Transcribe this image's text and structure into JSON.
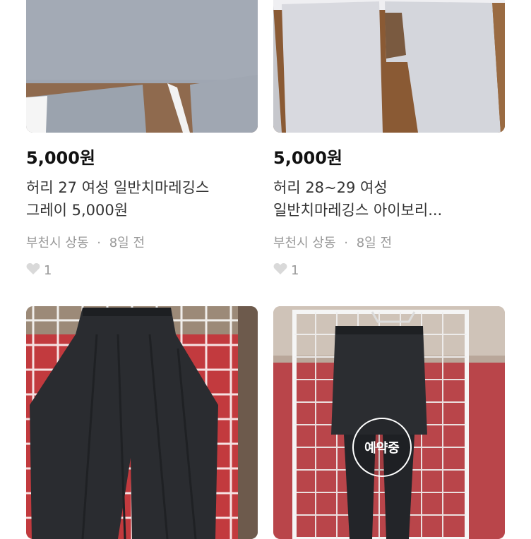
{
  "products": [
    {
      "price": "5,000원",
      "title_line1": "허리 27 여성 일반치마레깅스",
      "title_line2": "그레이 5,000원",
      "location": "부천시 상동",
      "time": "8일 전",
      "likes": "1",
      "image_desc": "gray-leggings"
    },
    {
      "price": "5,000원",
      "title_line1": "허리 28~29 여성",
      "title_line2": "일반치마레깅스 아이보리...",
      "location": "부천시 상동",
      "time": "8일 전",
      "likes": "1",
      "image_desc": "ivory-leggings"
    },
    {
      "image_desc": "black-wide-pants"
    },
    {
      "image_desc": "black-skirt-leggings",
      "badge": "예약중"
    }
  ],
  "meta_separator": "·",
  "colors": {
    "price_text": "#111111",
    "meta_text": "#999999",
    "heart": "#d9d9d9"
  }
}
